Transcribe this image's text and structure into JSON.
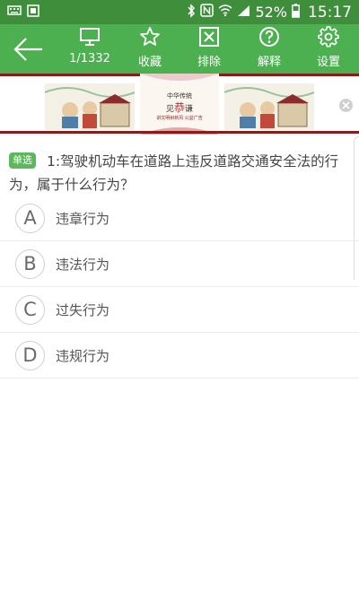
{
  "status_bar": {
    "battery": "52%",
    "time": "15:17"
  },
  "toolbar": {
    "progress": "1/1332",
    "favorite_label": "收藏",
    "exclude_label": "排除",
    "explain_label": "解释",
    "settings_label": "设置"
  },
  "ad": {
    "title": "中华传统",
    "main_prefix": "见",
    "main_red": "恭",
    "main_suffix": "谦",
    "sub": "讲文明树新风  公益广告"
  },
  "question": {
    "type_badge": "单选",
    "text": "1:驾驶机动车在道路上违反道路交通安全法的行为，属于什么行为？"
  },
  "options": [
    {
      "letter": "A",
      "text": "违章行为"
    },
    {
      "letter": "B",
      "text": "违法行为"
    },
    {
      "letter": "C",
      "text": "过失行为"
    },
    {
      "letter": "D",
      "text": "违规行为"
    }
  ],
  "colors": {
    "status_bar": "#3e8e3c",
    "toolbar": "#4caf50",
    "badge": "#5cb85c",
    "ad_border": "#8b1c1c"
  }
}
